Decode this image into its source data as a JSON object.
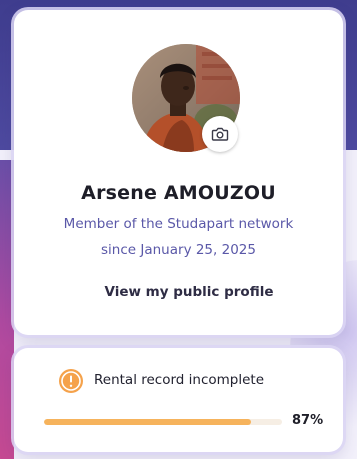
{
  "profile": {
    "avatar_icon": "profile-photo",
    "camera_icon": "camera-icon",
    "name": "Arsene AMOUZOU",
    "member_text": "Member of the Studapart network",
    "since_text": "since January 25, 2025",
    "public_profile_link": "View my public profile"
  },
  "rental_record": {
    "warning_icon": "warning-icon",
    "status_text": "Rental record incomplete",
    "progress_percent": 87,
    "progress_label": "87%"
  },
  "colors": {
    "accent_purple": "#5a58a8",
    "progress_orange": "#f6b35c",
    "warning_orange": "#f5a24b"
  }
}
